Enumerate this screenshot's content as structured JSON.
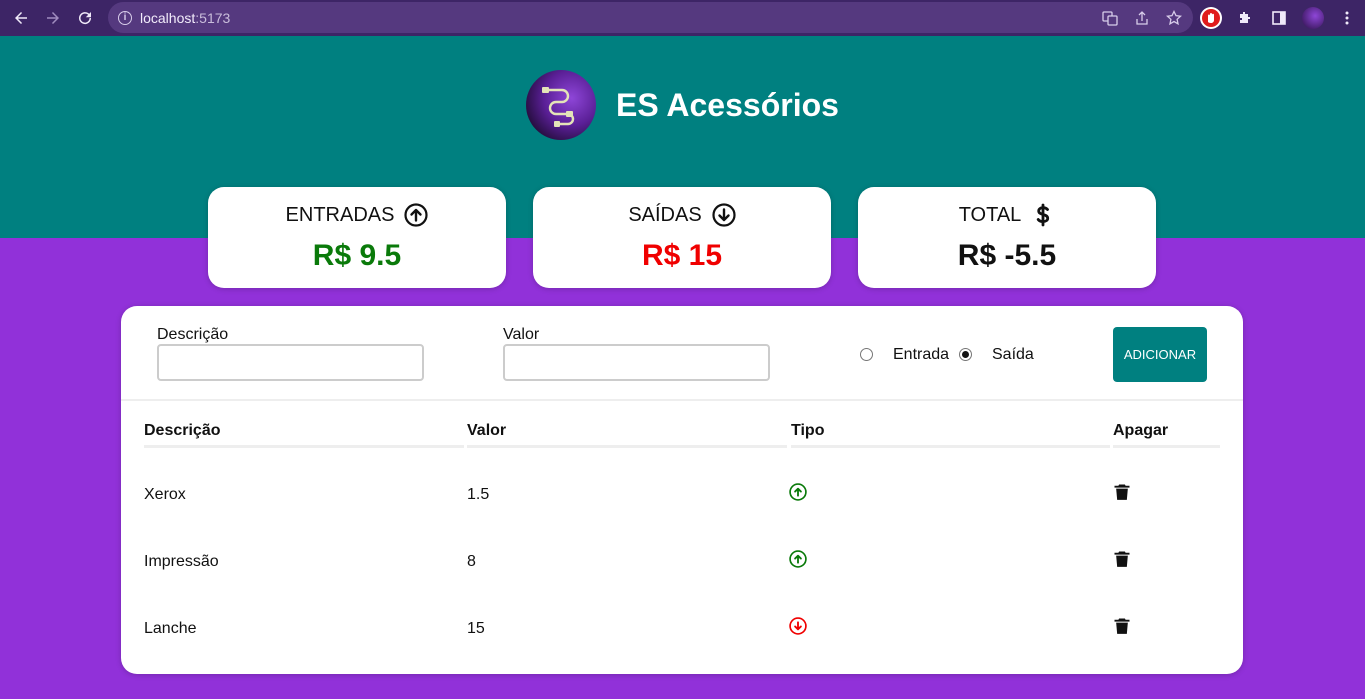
{
  "browser": {
    "url_host": "localhost",
    "url_port": ":5173"
  },
  "brand": {
    "name": "ES Acessórios"
  },
  "summary": {
    "income": {
      "label": "ENTRADAS",
      "value": "R$ 9.5",
      "color": "#0a7a0a"
    },
    "expense": {
      "label": "SAÍDAS",
      "value": "R$ 15",
      "color": "#f00000"
    },
    "total": {
      "label": "TOTAL",
      "value": "R$ -5.5",
      "color": "#111111"
    }
  },
  "form": {
    "description_label": "Descrição",
    "description_value": "",
    "value_label": "Valor",
    "value_value": "",
    "type_income_label": "Entrada",
    "type_expense_label": "Saída",
    "selected_type": "Saída",
    "add_label": "ADICIONAR"
  },
  "table": {
    "headers": [
      "Descrição",
      "Valor",
      "Tipo",
      "Apagar"
    ],
    "rows": [
      {
        "description": "Xerox",
        "value": "1.5",
        "type": "entrada"
      },
      {
        "description": "Impressão",
        "value": "8",
        "type": "entrada"
      },
      {
        "description": "Lanche",
        "value": "15",
        "type": "saida"
      }
    ]
  },
  "colors": {
    "header_bg": "#008080",
    "page_bg": "#9131d9",
    "income": "#0a7a0a",
    "expense": "#f00000"
  },
  "icons": {
    "income": "arrow-up-circle-icon",
    "expense": "arrow-down-circle-icon",
    "total": "dollar-icon",
    "delete": "trash-icon"
  }
}
